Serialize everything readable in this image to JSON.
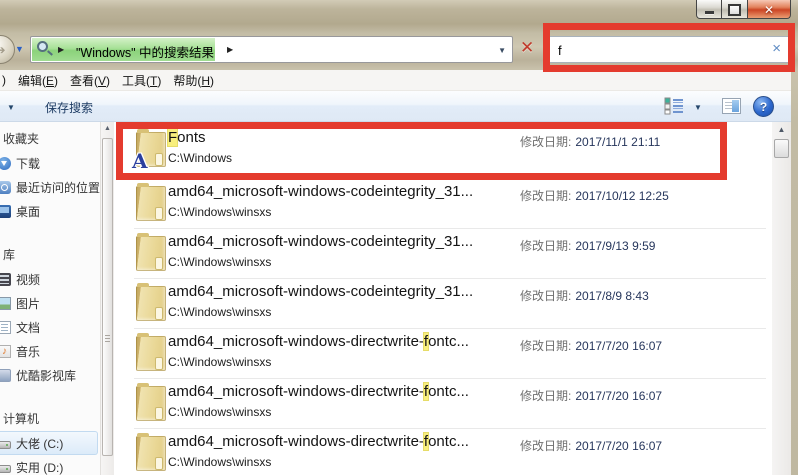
{
  "window": {
    "close_glyph": "✕"
  },
  "glyphs": {
    "crumb_arrow": "▶",
    "dropdown": "▼",
    "up_arrow": "▲",
    "forward_arrow": "➔"
  },
  "address_bar": {
    "breadcrumb": "\"Windows\" 中的搜索结果",
    "stop_glyph": "✕"
  },
  "search_box": {
    "value": "f",
    "clear_glyph": "×"
  },
  "menu_bar": {
    "file_fragment": ")",
    "items": [
      {
        "pre": "编辑(",
        "key": "E",
        "post": ")"
      },
      {
        "pre": "查看(",
        "key": "V",
        "post": ")"
      },
      {
        "pre": "工具(",
        "key": "T",
        "post": ")"
      },
      {
        "pre": "帮助(",
        "key": "H",
        "post": ")"
      }
    ]
  },
  "toolbar": {
    "save_search_label": "保存搜索",
    "help_glyph": "?"
  },
  "sidebar": {
    "sections": [
      {
        "header": "收藏夹",
        "items": [
          {
            "label": "下载",
            "icon": "download-icon"
          },
          {
            "label": "最近访问的位置",
            "icon": "recent-places-icon"
          },
          {
            "label": "桌面",
            "icon": "desktop-icon"
          }
        ]
      },
      {
        "header": "库",
        "items": [
          {
            "label": "视频",
            "icon": "videos-icon"
          },
          {
            "label": "图片",
            "icon": "pictures-icon"
          },
          {
            "label": "文档",
            "icon": "documents-icon"
          },
          {
            "label": "音乐",
            "icon": "music-icon"
          },
          {
            "label": "优酷影视库",
            "icon": "youku-library-icon"
          }
        ]
      },
      {
        "header": "计算机",
        "items": [
          {
            "label": "大佬 (C:)",
            "icon": "drive-icon",
            "selected": true
          },
          {
            "label": "实用 (D:)",
            "icon": "drive-icon"
          }
        ]
      }
    ]
  },
  "file_list": {
    "date_label": "修改日期:",
    "fonts_folder_letter": "A",
    "rows": [
      {
        "icon": "fonts-folder-icon",
        "name_pre": "",
        "name_hl": "F",
        "name_post": "onts",
        "path": "C:\\Windows",
        "date": "2017/11/1 21:11"
      },
      {
        "icon": "folder-icon",
        "name_pre": "amd64_microsoft-windows-codeintegrity_31...",
        "name_hl": "",
        "name_post": "",
        "path": "C:\\Windows\\winsxs",
        "date": "2017/10/12 12:25"
      },
      {
        "icon": "folder-icon",
        "name_pre": "amd64_microsoft-windows-codeintegrity_31...",
        "name_hl": "",
        "name_post": "",
        "path": "C:\\Windows\\winsxs",
        "date": "2017/9/13 9:59"
      },
      {
        "icon": "folder-icon",
        "name_pre": "amd64_microsoft-windows-codeintegrity_31...",
        "name_hl": "",
        "name_post": "",
        "path": "C:\\Windows\\winsxs",
        "date": "2017/8/9 8:43"
      },
      {
        "icon": "folder-icon",
        "name_pre": "amd64_microsoft-windows-directwrite-",
        "name_hl": "f",
        "name_post": "ontc...",
        "path": "C:\\Windows\\winsxs",
        "date": "2017/7/20 16:07"
      },
      {
        "icon": "folder-icon",
        "name_pre": "amd64_microsoft-windows-directwrite-",
        "name_hl": "f",
        "name_post": "ontc...",
        "path": "C:\\Windows\\winsxs",
        "date": "2017/7/20 16:07"
      },
      {
        "icon": "folder-icon",
        "name_pre": "amd64_microsoft-windows-directwrite-",
        "name_hl": "f",
        "name_post": "ontc...",
        "path": "C:\\Windows\\winsxs",
        "date": "2017/7/20 16:07"
      }
    ]
  },
  "annotation": {
    "color": "#e43b2e"
  }
}
